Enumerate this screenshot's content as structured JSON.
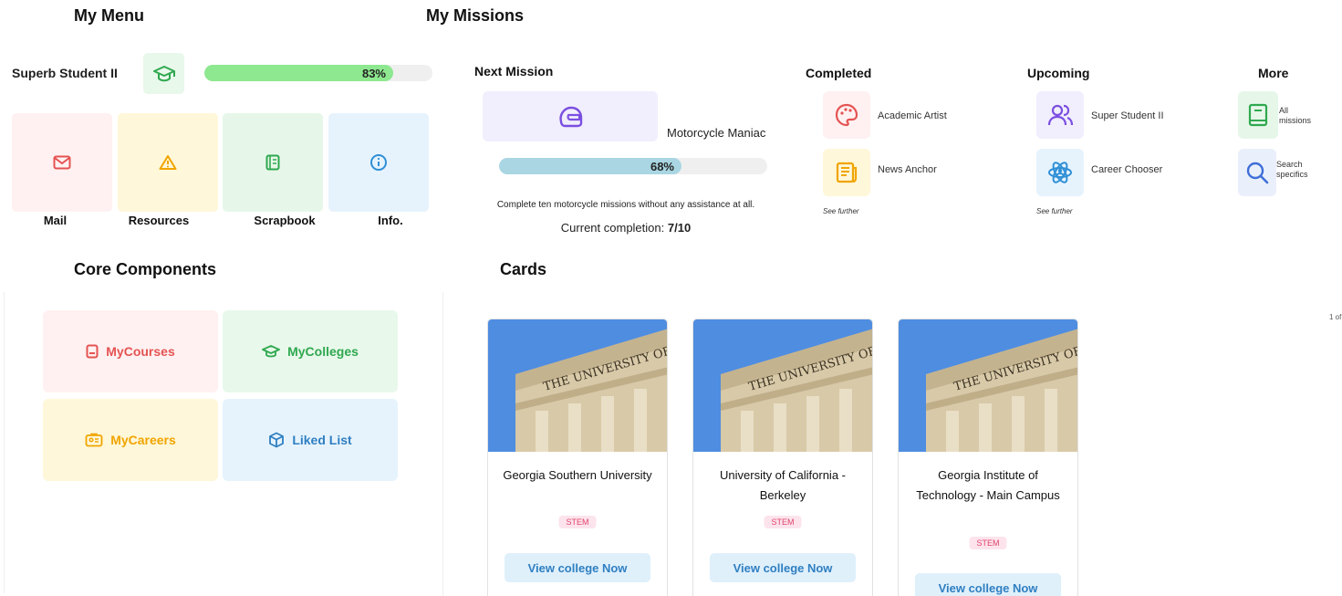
{
  "my_menu": {
    "title": "My Menu",
    "level_name": "Superb Student II",
    "level_progress_label": "83%",
    "level_progress": 0.83,
    "tiles": [
      {
        "label": "Mail",
        "icon": "mail-icon",
        "bg": "#fff1f1",
        "color": "#e55353"
      },
      {
        "label": "Resources",
        "icon": "warning-triangle-icon",
        "bg": "#fff7d9",
        "color": "#f0a500"
      },
      {
        "label": "Scrapbook",
        "icon": "notebook-icon",
        "bg": "#e6f7e9",
        "color": "#2fa84f"
      },
      {
        "label": "Info.",
        "icon": "info-icon",
        "bg": "#e6f3fd",
        "color": "#2f8fd6"
      }
    ]
  },
  "my_missions": {
    "title": "My Missions",
    "next_mission": {
      "heading": "Next Mission",
      "name": "Motorcycle Maniac",
      "icon": "helmet-icon",
      "progress_label": "68%",
      "progress": 0.68,
      "description": "Complete ten motorcycle missions without any assistance at all.",
      "completion_label": "Current completion:",
      "completion_value": "7/10"
    },
    "completed": {
      "heading": "Completed",
      "items": [
        {
          "label": "Academic Artist",
          "icon": "palette-icon"
        },
        {
          "label": "News Anchor",
          "icon": "newspaper-icon"
        }
      ],
      "see_further": "See further"
    },
    "upcoming": {
      "heading": "Upcoming",
      "items": [
        {
          "label": "Super Student II",
          "icon": "users-icon"
        },
        {
          "label": "Career Chooser",
          "icon": "atom-person-icon"
        }
      ],
      "see_further": "See further"
    },
    "more": {
      "heading": "More",
      "items": [
        {
          "label": "All missions",
          "line1": "All",
          "line2": "missions",
          "icon": "book-icon"
        },
        {
          "label": "Search specifics",
          "line1": "Search",
          "line2": "specifics",
          "icon": "search-icon"
        }
      ]
    }
  },
  "core_components": {
    "title": "Core Components",
    "items": [
      {
        "label": "MyCourses",
        "icon": "course-book-icon",
        "bg": "#fff1f1",
        "color": "#e55353"
      },
      {
        "label": "MyColleges",
        "icon": "graduation-cap-icon",
        "bg": "#e8f8eb",
        "color": "#2fa84f"
      },
      {
        "label": "MyCareers",
        "icon": "id-card-icon",
        "bg": "#fff7d9",
        "color": "#f0a500"
      },
      {
        "label": "Liked List",
        "icon": "cube-icon",
        "bg": "#e6f3fd",
        "color": "#2f7fc1"
      }
    ]
  },
  "cards": {
    "title": "Cards",
    "pager": "1 of",
    "items": [
      {
        "name": "Georgia Southern University",
        "tag": "STEM",
        "button": "View college Now"
      },
      {
        "name": "University of California - Berkeley",
        "tag": "STEM",
        "button": "View college Now"
      },
      {
        "name": "Georgia Institute of Technology - Main Campus",
        "tag": "STEM",
        "button": "View college Now"
      }
    ],
    "photo_text": "THE UNIVERSITY OF"
  },
  "colors": {
    "level_bar": "#8de88f",
    "mission_bar": "#a9d6e2",
    "mission_icon": "#7b4fe0"
  }
}
